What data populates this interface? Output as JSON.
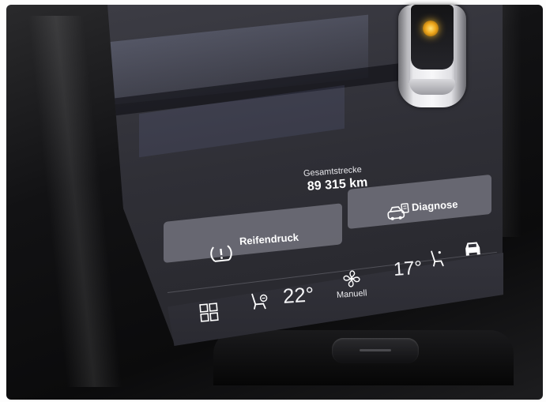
{
  "odometer": {
    "label": "Gesamtstrecke",
    "value": "89 315 km"
  },
  "tiles": {
    "diagnose_label": "Diagnose",
    "reifendruck_label": "Reifendruck"
  },
  "climate": {
    "temp_left": "22°",
    "fan_label": "Manuell",
    "temp_right": "17°"
  },
  "icons": {
    "diagnose": "car-diagnostics-icon",
    "tpms": "tire-pressure-icon",
    "home": "home-grid-icon",
    "seat_heat_left": "seat-heating-icon",
    "fan": "fan-icon",
    "seat_right": "seat-icon",
    "car_front": "car-front-icon"
  },
  "colors": {
    "screen_bg": "#2f2f36",
    "tile_bg": "#6e6e78",
    "text": "#ffffff",
    "indicator": "#f0b62c"
  }
}
